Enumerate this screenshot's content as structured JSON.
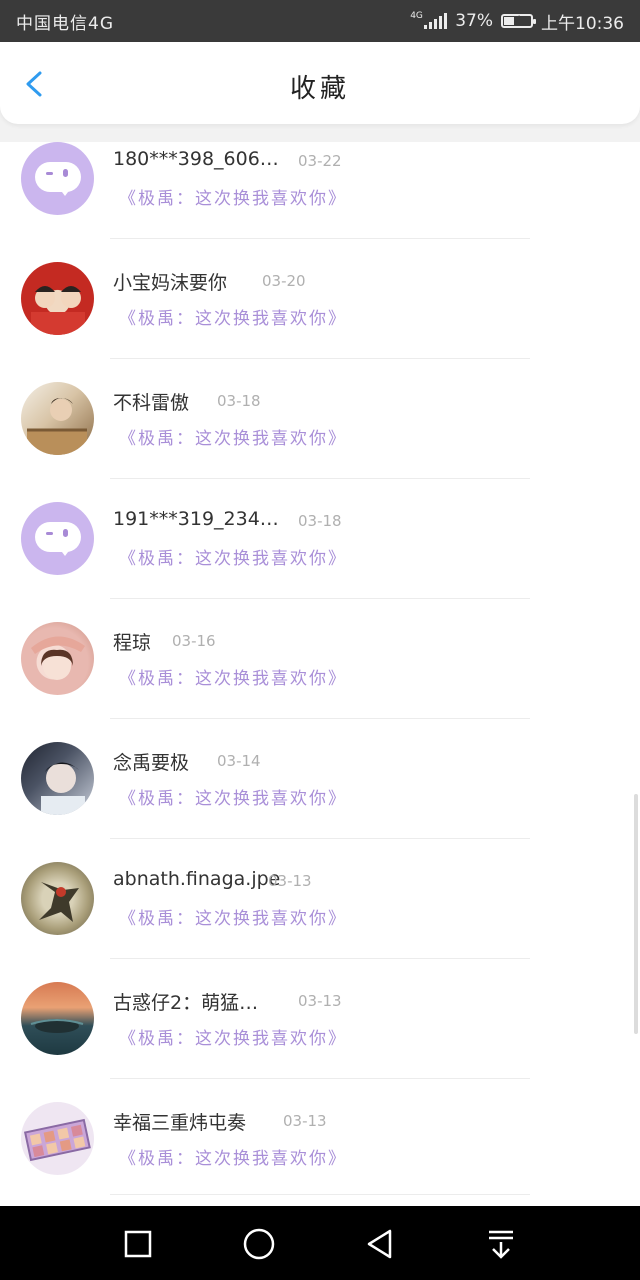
{
  "status_bar": {
    "carrier": "中国电信4G",
    "network": "4G",
    "battery_percent": "37%",
    "battery_level": 0.37,
    "time": "上午10:36"
  },
  "header": {
    "title": "收藏",
    "accent_color": "#2f9bef"
  },
  "list": {
    "items": [
      {
        "name": "180***398_60602…",
        "date": "03-22",
        "message": "《极禹：这次换我喜欢你》",
        "avatar": "default-chat-avatar"
      },
      {
        "name": "小宝妈沫要你",
        "date": "03-20",
        "message": "《极禹：这次换我喜欢你》",
        "avatar": "photo-avatar"
      },
      {
        "name": "不科雷傲",
        "date": "03-18",
        "message": "《极禹：这次换我喜欢你》",
        "avatar": "photo-avatar"
      },
      {
        "name": "191***319_23433…",
        "date": "03-18",
        "message": "《极禹：这次换我喜欢你》",
        "avatar": "default-chat-avatar"
      },
      {
        "name": "程琼",
        "date": "03-16",
        "message": "《极禹：这次换我喜欢你》",
        "avatar": "photo-avatar"
      },
      {
        "name": "念禹要极",
        "date": "03-14",
        "message": "《极禹：这次换我喜欢你》",
        "avatar": "photo-avatar"
      },
      {
        "name": "abnath.finaga.jpe",
        "date": "03-13",
        "message": "《极禹：这次换我喜欢你》",
        "avatar": "photo-avatar"
      },
      {
        "name": "古惑仔2：萌猛…",
        "date": "03-13",
        "message": "《极禹：这次换我喜欢你》",
        "avatar": "photo-avatar"
      },
      {
        "name": "幸福三重炜屯奏",
        "date": "03-13",
        "message": "《极禹：这次换我喜欢你》",
        "avatar": "photo-avatar"
      }
    ],
    "message_color": "#a98fd8"
  },
  "nav_bar": {
    "buttons": [
      "recent-apps",
      "home",
      "back",
      "notifications-pulldown"
    ]
  }
}
